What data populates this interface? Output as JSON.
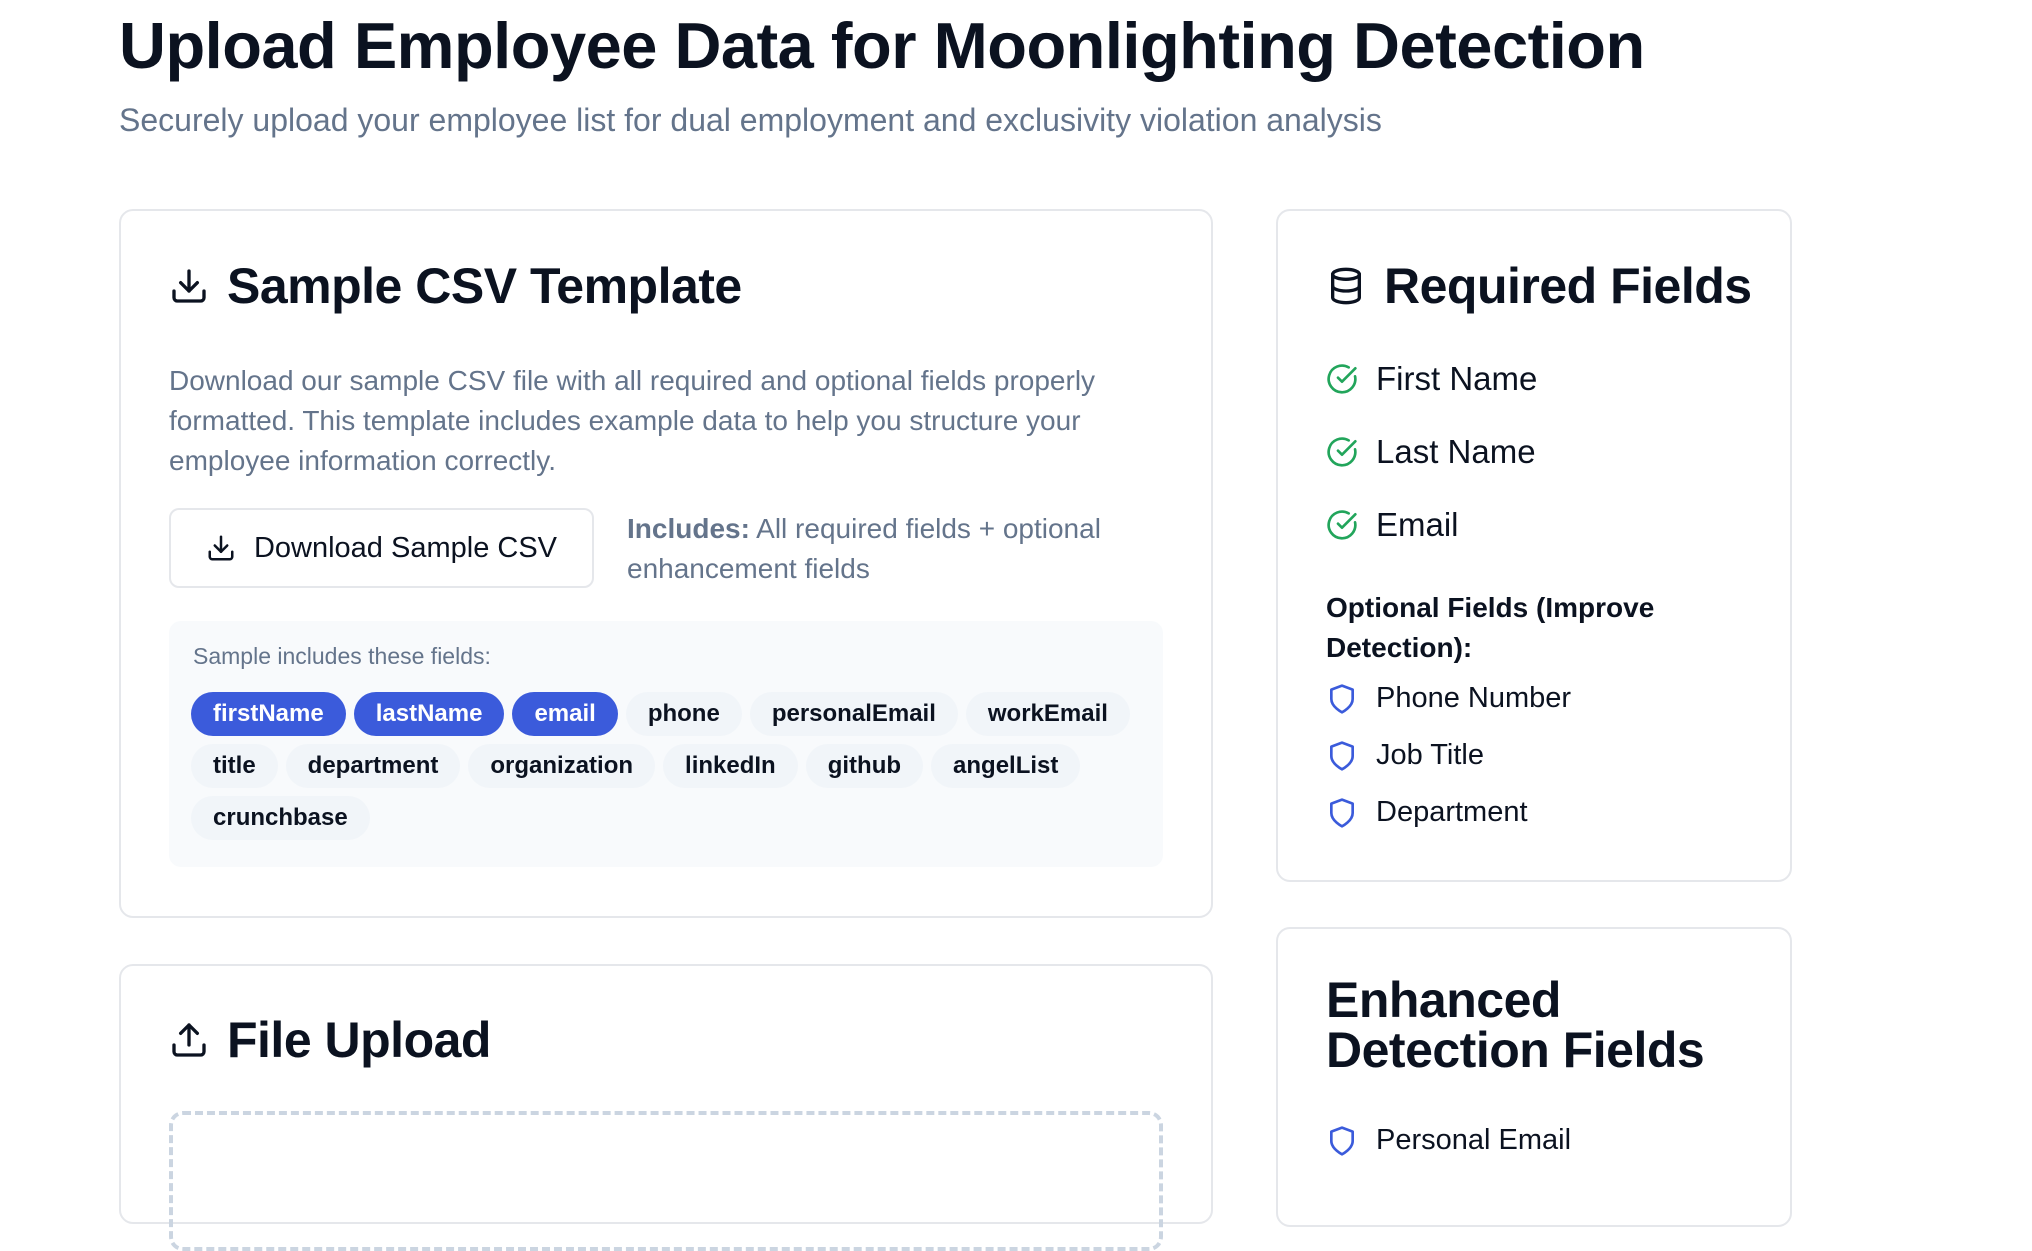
{
  "page": {
    "title": "Upload Employee Data for Moonlighting Detection",
    "subtitle": "Securely upload your employee list for dual employment and exclusivity violation analysis"
  },
  "template_card": {
    "title": "Sample CSV Template",
    "icon": "download-icon",
    "description": "Download our sample CSV file with all required and optional fields properly formatted. This template includes example data to help you structure your employee information correctly.",
    "download_button_label": "Download Sample CSV",
    "includes_label": "Includes:",
    "includes_text": " All required fields + optional enhancement fields",
    "fields_caption": "Sample includes these fields:",
    "fields": [
      {
        "label": "firstName",
        "required": true
      },
      {
        "label": "lastName",
        "required": true
      },
      {
        "label": "email",
        "required": true
      },
      {
        "label": "phone",
        "required": false
      },
      {
        "label": "personalEmail",
        "required": false
      },
      {
        "label": "workEmail",
        "required": false
      },
      {
        "label": "title",
        "required": false
      },
      {
        "label": "department",
        "required": false
      },
      {
        "label": "organization",
        "required": false
      },
      {
        "label": "linkedIn",
        "required": false
      },
      {
        "label": "github",
        "required": false
      },
      {
        "label": "angelList",
        "required": false
      },
      {
        "label": "crunchbase",
        "required": false
      }
    ]
  },
  "upload_card": {
    "title": "File Upload",
    "icon": "upload-icon"
  },
  "required_card": {
    "title": "Required Fields",
    "icon": "database-icon",
    "required_items": [
      "First Name",
      "Last Name",
      "Email"
    ],
    "optional_heading": "Optional Fields (Improve Detection):",
    "optional_items": [
      "Phone Number",
      "Job Title",
      "Department"
    ]
  },
  "enhanced_card": {
    "title": "Enhanced Detection Fields",
    "items": [
      "Personal Email"
    ]
  },
  "colors": {
    "accent": "#3b5bdb",
    "success": "#22a55b",
    "muted_text": "#64748b",
    "border": "#e5e7eb",
    "chip_bg": "#f1f5f9"
  }
}
